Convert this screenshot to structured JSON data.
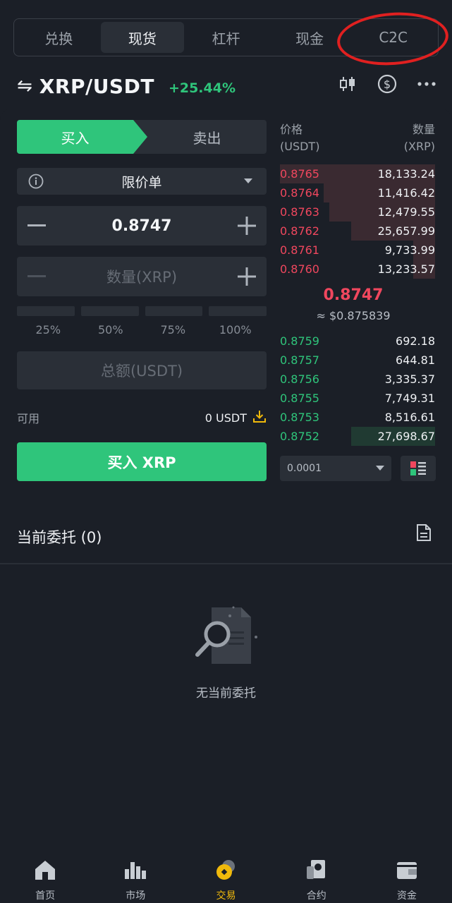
{
  "top_tabs": [
    {
      "label": "兑换",
      "active": false
    },
    {
      "label": "现货",
      "active": true
    },
    {
      "label": "杠杆",
      "active": false
    },
    {
      "label": "现金",
      "active": false
    },
    {
      "label": "C2C",
      "active": false
    }
  ],
  "pair": {
    "swap_icon": "⇋",
    "name": "XRP/USDT",
    "change": "+25.44%"
  },
  "trade": {
    "buy_tab": "买入",
    "sell_tab": "卖出",
    "order_type": "限价单",
    "price": "0.8747",
    "quantity_placeholder": "数量(XRP)",
    "percents": [
      "25%",
      "50%",
      "75%",
      "100%"
    ],
    "total_placeholder": "总额(USDT)",
    "available_label": "可用",
    "available_value": "0 USDT",
    "buy_button": "买入 XRP"
  },
  "orderbook": {
    "price_header": "价格",
    "price_unit": "(USDT)",
    "qty_header": "数量",
    "qty_unit": "(XRP)",
    "asks": [
      {
        "price": "0.8765",
        "qty": "18,133.24",
        "depth": 1.0
      },
      {
        "price": "0.8764",
        "qty": "11,416.42",
        "depth": 0.72
      },
      {
        "price": "0.8763",
        "qty": "12,479.55",
        "depth": 0.68
      },
      {
        "price": "0.8762",
        "qty": "25,657.99",
        "depth": 0.54
      },
      {
        "price": "0.8761",
        "qty": "9,733.99",
        "depth": 0.14
      },
      {
        "price": "0.8760",
        "qty": "13,233.57",
        "depth": 0.14
      }
    ],
    "mid_price": "0.8747",
    "mid_usd": "≈ $0.875839",
    "bids": [
      {
        "price": "0.8759",
        "qty": "692.18",
        "depth": 0
      },
      {
        "price": "0.8757",
        "qty": "644.81",
        "depth": 0
      },
      {
        "price": "0.8756",
        "qty": "3,335.37",
        "depth": 0
      },
      {
        "price": "0.8755",
        "qty": "7,749.31",
        "depth": 0
      },
      {
        "price": "0.8753",
        "qty": "8,516.61",
        "depth": 0
      },
      {
        "price": "0.8752",
        "qty": "27,698.67",
        "depth": 0.54
      }
    ],
    "precision": "0.0001"
  },
  "orders": {
    "title": "当前委托 (0)",
    "empty_text": "无当前委托"
  },
  "nav": [
    {
      "label": "首页",
      "icon": "home-icon",
      "active": false
    },
    {
      "label": "市场",
      "icon": "market-icon",
      "active": false
    },
    {
      "label": "交易",
      "icon": "trade-icon",
      "active": true
    },
    {
      "label": "合约",
      "icon": "futures-icon",
      "active": false
    },
    {
      "label": "资金",
      "icon": "wallet-icon",
      "active": false
    }
  ],
  "colors": {
    "green": "#2fc57b",
    "red": "#f0475e",
    "accent": "#f0b90b",
    "background": "#1b1f27",
    "annotation": "#e02020"
  }
}
